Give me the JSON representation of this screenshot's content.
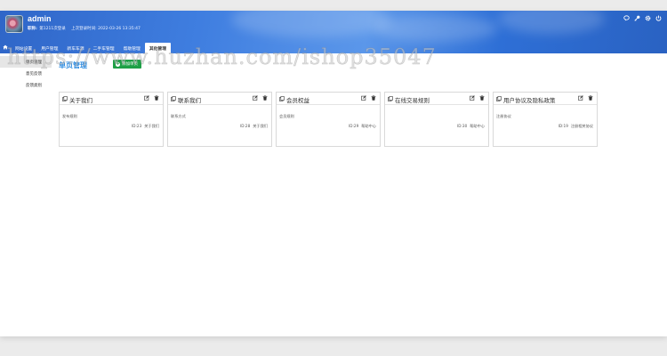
{
  "header": {
    "admin_name": "admin",
    "meta": {
      "role_label": "职称:",
      "login_count": "第1211次登录",
      "last_login": "上次登录时间: 2022-03-26 13:35:47"
    },
    "tools": [
      {
        "icon": "chat-icon"
      },
      {
        "icon": "key-icon"
      },
      {
        "icon": "gear-icon"
      },
      {
        "icon": "power-icon"
      }
    ]
  },
  "tabs": [
    {
      "label": "网站设置",
      "active": false
    },
    {
      "label": "用户管理",
      "active": false
    },
    {
      "label": "新车车源",
      "active": false
    },
    {
      "label": "二手车管理",
      "active": false
    },
    {
      "label": "帮助管理",
      "active": false
    },
    {
      "label": "其他管理",
      "active": true
    }
  ],
  "sidebar": {
    "items": [
      {
        "label": "单页管理",
        "active": true
      },
      {
        "label": "意见反馈",
        "active": false
      },
      {
        "label": "反馈类别",
        "active": false
      }
    ]
  },
  "main": {
    "title": "单页管理",
    "add_button": "添加单页",
    "cards": [
      {
        "title": "关于我们",
        "subtitle": "发布规则",
        "id": "ID:23",
        "category": "关于我们"
      },
      {
        "title": "联系我们",
        "subtitle": "联系方式",
        "id": "ID:28",
        "category": "关于我们"
      },
      {
        "title": "会员权益",
        "subtitle": "会员规则",
        "id": "ID:29",
        "category": "帮助中心"
      },
      {
        "title": "在线交易规则",
        "subtitle": "",
        "id": "ID:30",
        "category": "帮助中心"
      },
      {
        "title": "用户协议及隐私政策",
        "subtitle": "注册协议",
        "id": "ID:19",
        "category": "注册相关协议"
      }
    ]
  },
  "watermark": "https://www.huzhan.com/ishop35047",
  "colors": {
    "header_blue": "#3f7ee0",
    "title_blue": "#2a8ae0",
    "add_green": "#1ea046"
  }
}
